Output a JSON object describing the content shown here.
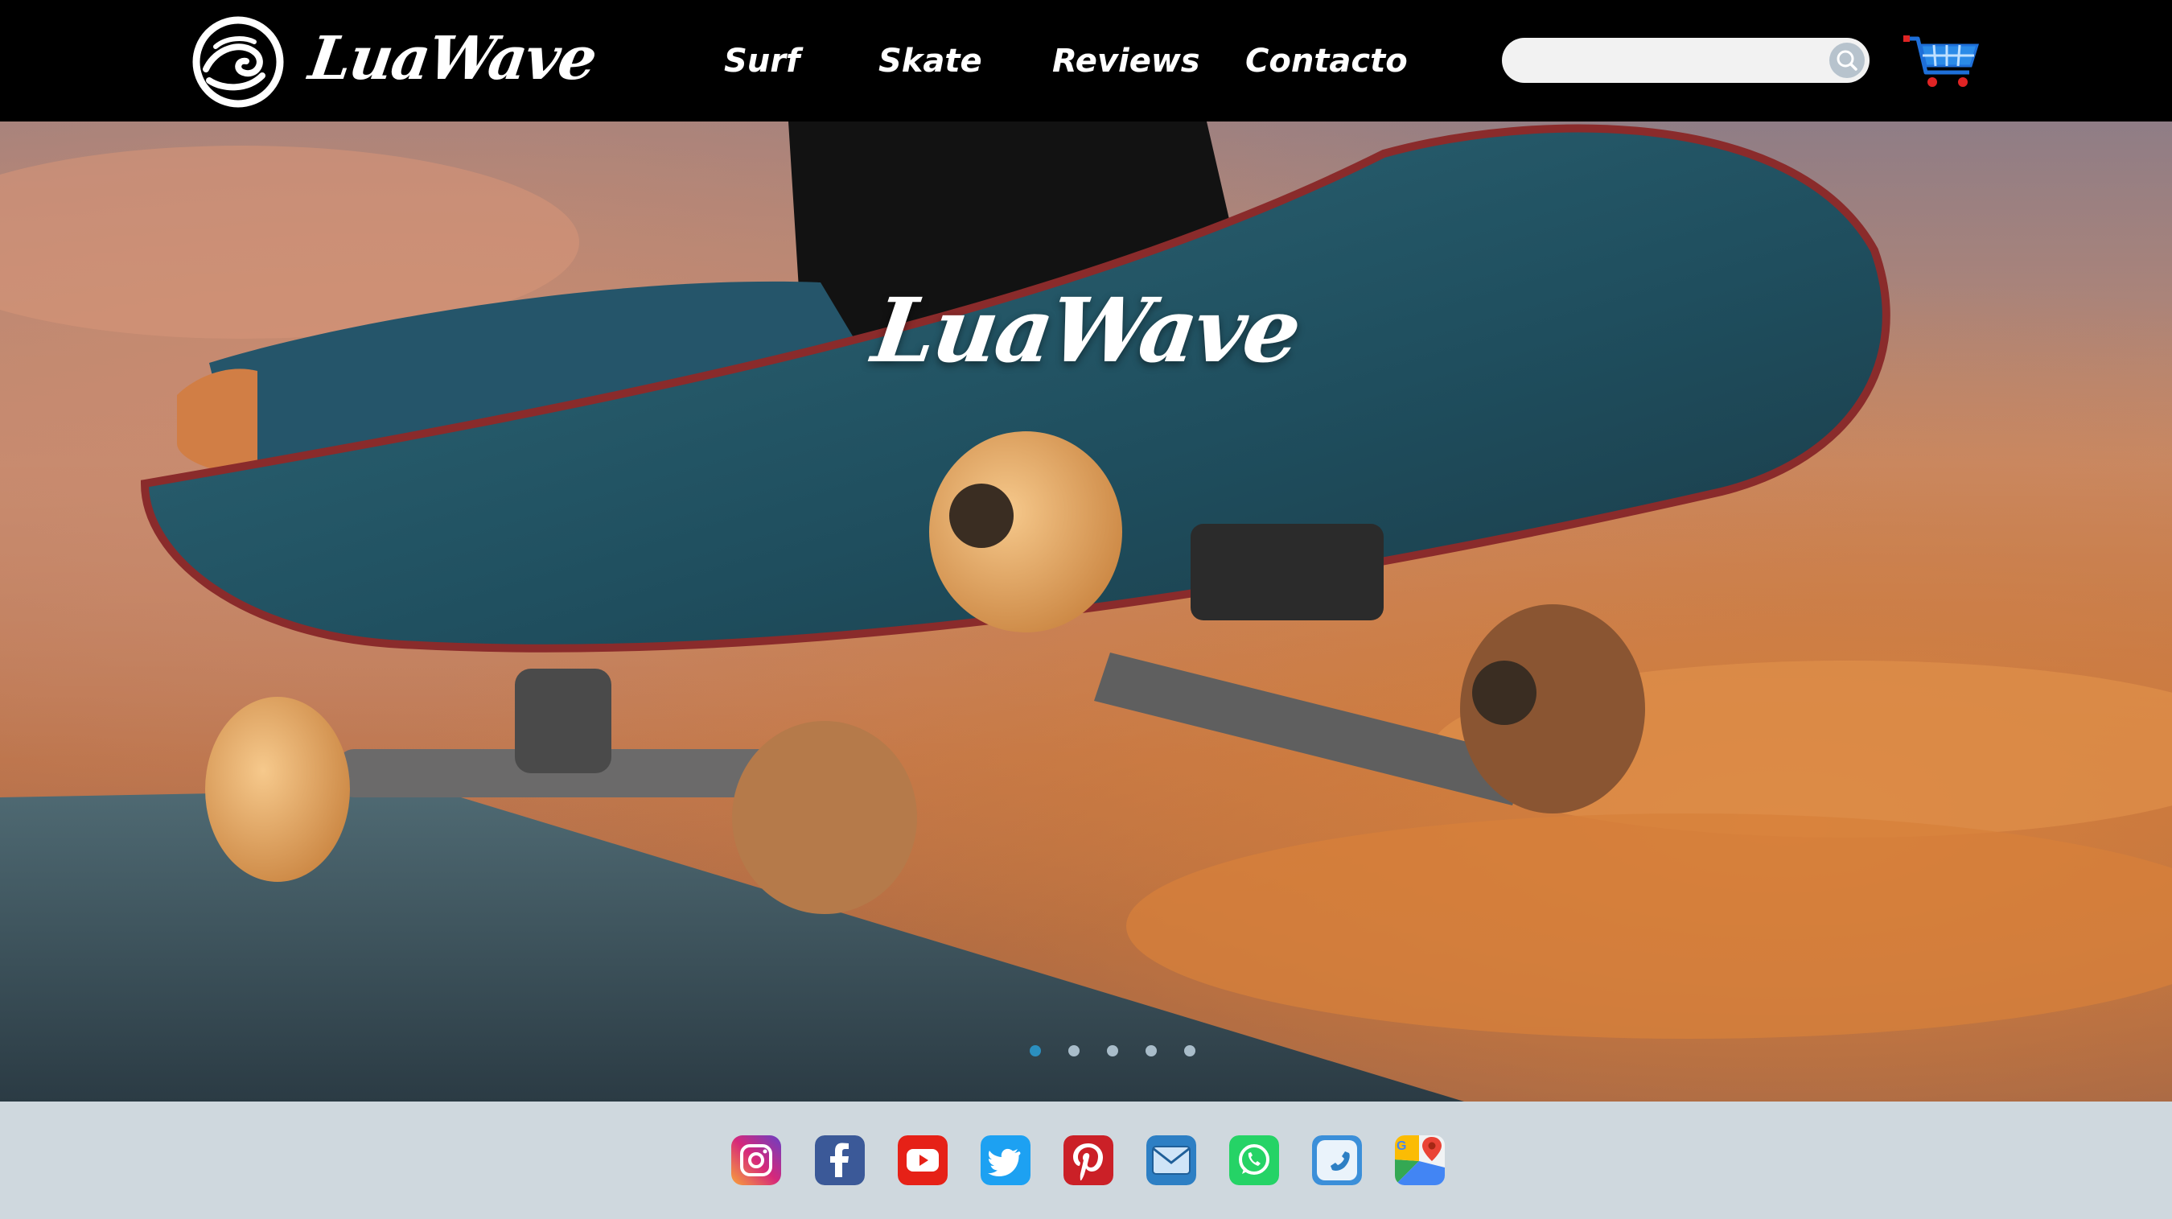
{
  "header": {
    "brand": "LuaWave",
    "logo_icon": "wave-spiral-logo-icon",
    "nav": [
      {
        "label": "Surf"
      },
      {
        "label": "Skate"
      },
      {
        "label": "Reviews"
      },
      {
        "label": "Contacto"
      }
    ],
    "search": {
      "placeholder": "",
      "value": "",
      "icon": "search-icon"
    },
    "cart_icon": "shopping-cart-icon"
  },
  "hero": {
    "title": "LuaWave",
    "image": "skateboard-on-ramp-sunset-photo",
    "slides_count": 5,
    "active_slide": 1
  },
  "footer": {
    "social": [
      {
        "icon": "instagram-icon",
        "color": "#d6287a"
      },
      {
        "icon": "facebook-icon",
        "color": "#3b5998"
      },
      {
        "icon": "youtube-icon",
        "color": "#e62117"
      },
      {
        "icon": "twitter-icon",
        "color": "#1da1f2"
      },
      {
        "icon": "pinterest-icon",
        "color": "#cb2027"
      },
      {
        "icon": "email-icon",
        "color": "#2d7fc4"
      },
      {
        "icon": "whatsapp-icon",
        "color": "#25d366"
      },
      {
        "icon": "phone-icon",
        "color": "#3b8fd9"
      },
      {
        "icon": "google-maps-icon",
        "color": "#34a853"
      }
    ]
  },
  "colors": {
    "header_bg": "#000000",
    "footer_bg": "#cfd8de",
    "accent": "#2b8fbf"
  }
}
